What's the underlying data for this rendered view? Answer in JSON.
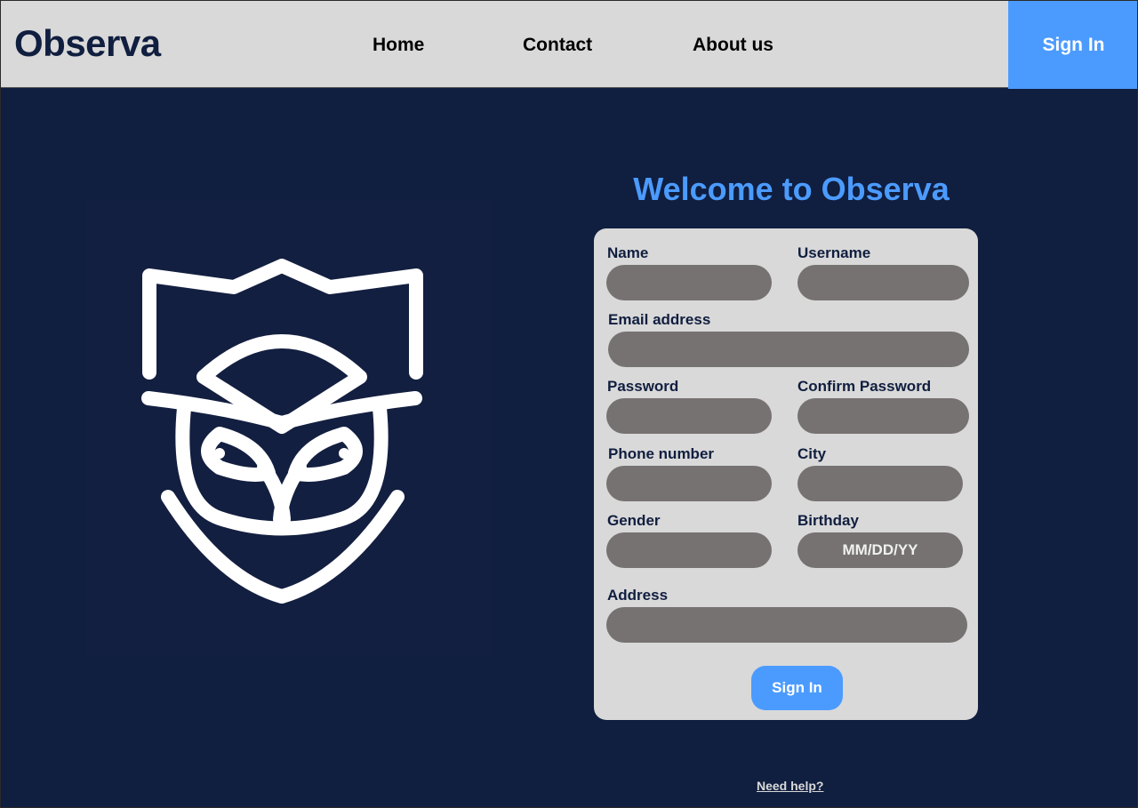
{
  "header": {
    "brand": "Observa",
    "nav": {
      "home": "Home",
      "contact": "Contact",
      "about": "About us"
    },
    "signin_label": "Sign In"
  },
  "logo": {
    "icon": "owl-shield-logo"
  },
  "main": {
    "welcome": "Welcome to Observa"
  },
  "form": {
    "name_label": "Name",
    "username_label": "Username",
    "email_label": "Email address",
    "password_label": "Password",
    "confirm_password_label": "Confirm Password",
    "phone_label": "Phone number",
    "city_label": "City",
    "gender_label": "Gender",
    "birthday_label": "Birthday",
    "birthday_placeholder": "MM/DD/YY",
    "address_label": "Address",
    "submit_label": "Sign In"
  },
  "footer": {
    "help": "Need help?"
  },
  "colors": {
    "background": "#101e3f",
    "header": "#d9d9d9",
    "accent": "#4b9bff",
    "input": "#767271"
  }
}
